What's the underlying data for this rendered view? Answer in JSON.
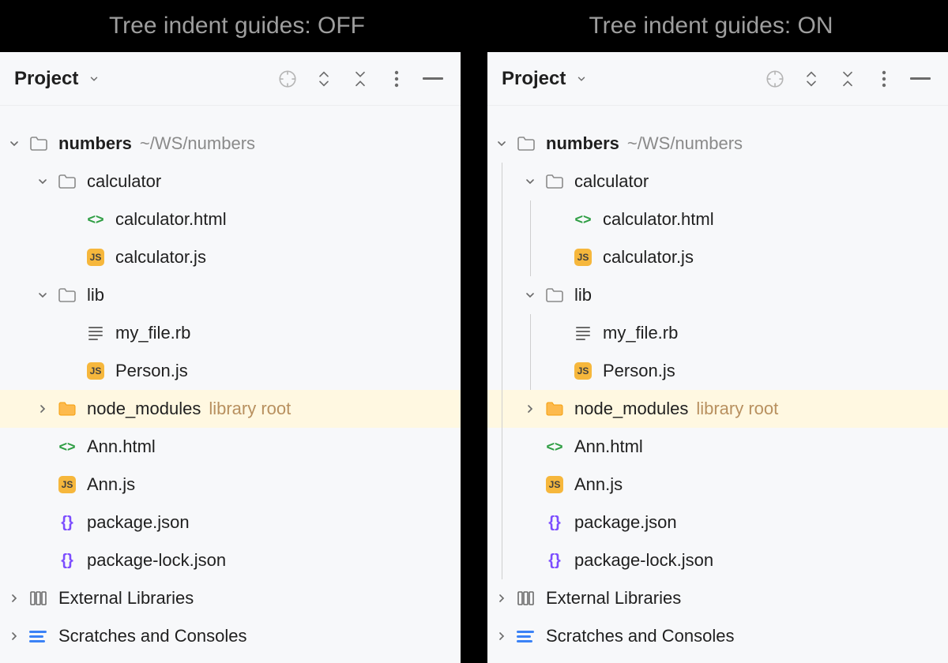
{
  "headers": {
    "off_label": "Tree indent guides: OFF",
    "on_label": "Tree indent guides: ON"
  },
  "panel_title": "Project",
  "tree": {
    "root": {
      "name": "numbers",
      "path": "~/WS/numbers"
    },
    "calculator": {
      "name": "calculator",
      "children": {
        "html": "calculator.html",
        "js": "calculator.js"
      }
    },
    "lib": {
      "name": "lib",
      "children": {
        "rb": "my_file.rb",
        "js": "Person.js"
      }
    },
    "node_modules": {
      "name": "node_modules",
      "tag": "library root"
    },
    "ann_html": "Ann.html",
    "ann_js": "Ann.js",
    "package_json": "package.json",
    "package_lock": "package-lock.json",
    "external_libraries": "External Libraries",
    "scratches": "Scratches and Consoles"
  },
  "icons": {
    "js_badge": "JS"
  }
}
